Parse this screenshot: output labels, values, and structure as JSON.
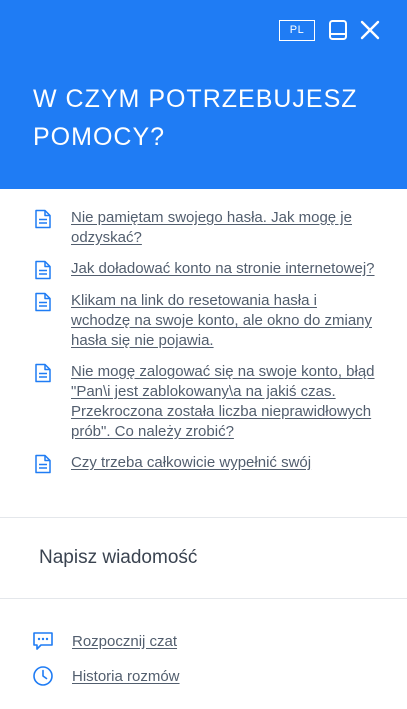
{
  "header": {
    "lang_badge": "PL",
    "title": "W CZYM POTRZEBUJESZ POMOCY?",
    "background": "#1f7cf4",
    "minimize_icon": "minimize-window-icon",
    "close_icon": "close-icon"
  },
  "faq": {
    "icon": "document-icon",
    "items": [
      {
        "label": "Nie pamiętam swojego hasła. Jak mogę je odzyskać?"
      },
      {
        "label": "Jak doładować konto na stronie internetowej?"
      },
      {
        "label": "Klikam na link do resetowania hasła i wchodzę na swoje konto, ale okno do zmiany hasła się nie pojawia."
      },
      {
        "label": "Nie mogę zalogować się na swoje konto, błąd \"Pan\\i jest zablokowany\\a na jakiś czas. Przekroczona została liczba nieprawidłowych prób\". Co należy zrobić?"
      },
      {
        "label": "Czy trzeba całkowicie wypełnić swój"
      }
    ]
  },
  "compose": {
    "placeholder": "Napisz wiadomość"
  },
  "actions": {
    "start_chat": "Rozpocznij czat",
    "history": "Historia rozmów"
  },
  "colors": {
    "accent": "#1f7cf4",
    "text": "#525e6e"
  }
}
